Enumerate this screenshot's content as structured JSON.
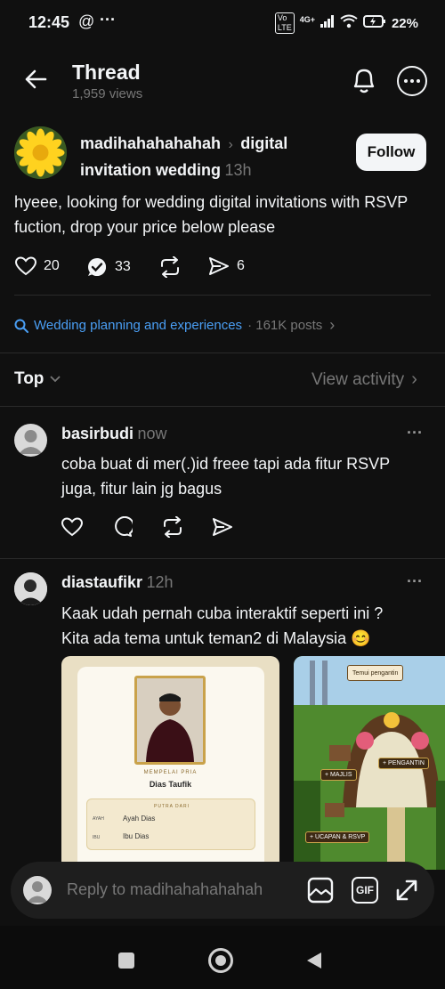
{
  "status_bar": {
    "time": "12:45",
    "battery": "22%",
    "network": "4G+"
  },
  "header": {
    "title": "Thread",
    "views": "1,959 views"
  },
  "post": {
    "author": "madihahahahahah",
    "topic": "digital invitation wedding",
    "time": "13h",
    "follow_label": "Follow",
    "text": "hyeee, looking for wedding digital invitations with RSVP fuction, drop your price below please",
    "likes": "20",
    "replies": "33",
    "shares": "6"
  },
  "topic_link": {
    "label": "Wedding planning and experiences",
    "posts": "· 161K posts"
  },
  "sort": {
    "label": "Top",
    "view_activity": "View activity"
  },
  "replies": [
    {
      "author": "basirbudi",
      "time": "now",
      "text_line1": "coba buat di mer(.)id freee tapi ada fitur RSVP",
      "text_line2": "juga, fitur lain jg bagus"
    },
    {
      "author": "diastaufikr",
      "time": "12h",
      "text_line1": "Kaak udah pernah cuba interaktif seperti ini ?",
      "text_line2": "Kita ada tema untuk teman2 di Malaysia 😊"
    }
  ],
  "invitation_card": {
    "role": "MEMPELAI PRIA",
    "name": "Dias Taufik",
    "parents_title": "PUTRA DARI",
    "ayah_label": "AYAH",
    "ayah_value": "Ayah Dias",
    "ibu_label": "IBU",
    "ibu_value": "Ibu Dias"
  },
  "game_card": {
    "top_label": "Temui pengantin",
    "pengantin": "+ PENGANTIN",
    "majlis": "+ MAJLIS",
    "ucapan": "+ UCAPAN & RSVP"
  },
  "reply_bar": {
    "placeholder": "Reply to madihahahahahah",
    "gif": "GIF"
  },
  "colors": {
    "background": "#101010",
    "link": "#4a9ff5",
    "muted": "#777777"
  }
}
